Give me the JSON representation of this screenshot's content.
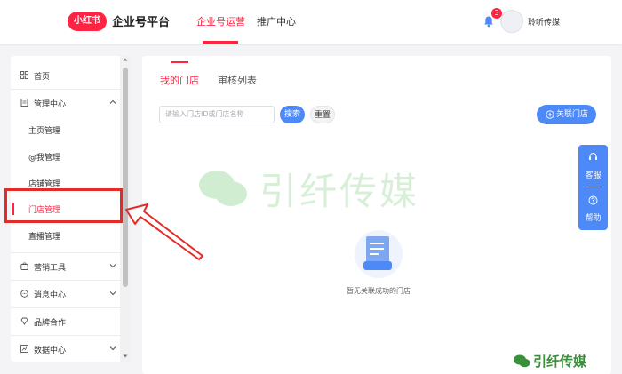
{
  "header": {
    "logo_text": "小红书",
    "brand": "企业号平台",
    "nav": [
      "企业号运营",
      "推广中心"
    ],
    "notification_count": "3",
    "username": "聆听传媒"
  },
  "sidebar": {
    "items": [
      {
        "label": "首页",
        "icon": "home-grid-icon"
      },
      {
        "label": "管理中心",
        "icon": "document-icon"
      },
      {
        "label": "主页管理"
      },
      {
        "label": "@我管理"
      },
      {
        "label": "店铺管理"
      },
      {
        "label": "门店管理"
      },
      {
        "label": "直播管理"
      },
      {
        "label": "营销工具",
        "icon": "bag-icon"
      },
      {
        "label": "消息中心",
        "icon": "message-icon"
      },
      {
        "label": "品牌合作",
        "icon": "diamond-icon"
      },
      {
        "label": "数据中心",
        "icon": "chart-icon"
      }
    ]
  },
  "main": {
    "tabs": [
      "我的门店",
      "审核列表"
    ],
    "search_placeholder": "请输入门店ID或门店名称",
    "search_button": "搜索",
    "reset_button": "重置",
    "link_button": "关联门店",
    "empty_text": "暂无关联成功的门店"
  },
  "watermark_text": "引纤传媒",
  "float_panel": {
    "service": "客服",
    "help": "帮助"
  },
  "bottom_watermark": "引纤传媒",
  "colors": {
    "brand_red": "#ff2442",
    "primary_blue": "#4e8af7",
    "annotation_red": "#e22c2c",
    "wechat_green": "#4cb94c"
  }
}
